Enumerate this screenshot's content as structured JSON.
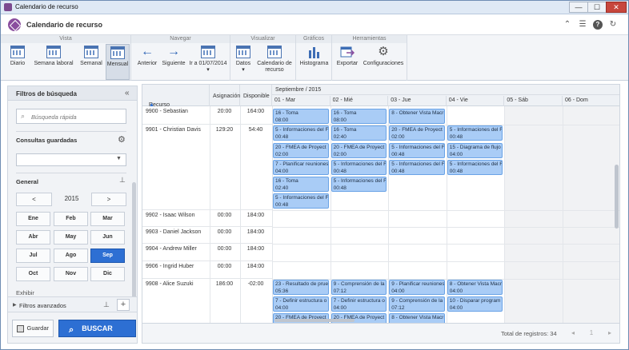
{
  "window": {
    "title": "Calendario de recurso",
    "minimize": "—",
    "maximize": "☐",
    "close": "✕"
  },
  "header": {
    "title": "Calendario de recurso"
  },
  "ribbon": {
    "groups": [
      "Vista",
      "Navegar",
      "Visualizar",
      "Gráficos",
      "Herramientas"
    ],
    "vista": [
      "Diario",
      "Semana laboral",
      "Semanal",
      "Mensual"
    ],
    "navegar": [
      "Anterior",
      "Siguiente",
      "Ir a 01/07/2014"
    ],
    "visualizar": [
      "Datos",
      "Calendario de recurso"
    ],
    "graficos": [
      "Histograma"
    ],
    "herramientas": [
      "Exportar",
      "Configuraciones"
    ]
  },
  "sidebar": {
    "title": "Filtros de búsqueda",
    "search_placeholder": "Búsqueda rápida",
    "saved_queries": "Consultas guardadas",
    "general": "General",
    "prev": "<",
    "next": ">",
    "year": "2015",
    "months": [
      "Ene",
      "Feb",
      "Mar",
      "Abr",
      "May",
      "Jun",
      "Jul",
      "Ago",
      "Sep",
      "Oct",
      "Nov",
      "Dic"
    ],
    "selected_month": "Sep",
    "exhibir": "Exhibir",
    "advanced": "Filtros avanzados",
    "save": "Guardar",
    "search_btn": "BUSCAR"
  },
  "grid": {
    "columns": [
      "Recurso",
      "Asignación",
      "Disponible"
    ],
    "month_label": "Septiembre / 2015",
    "days": [
      "01 - Mar",
      "02 - Mié",
      "03 - Jue",
      "04 - Vie",
      "05 - Sáb",
      "06 - Dom"
    ],
    "rows": [
      {
        "name": "9900 - Sebastian",
        "asig": "20:00",
        "disp": "164:00"
      },
      {
        "name": "9901 - Christian Davis",
        "asig": "129:20",
        "disp": "54:40"
      },
      {
        "name": "9902 - Isaac Wilson",
        "asig": "00:00",
        "disp": "184:00"
      },
      {
        "name": "9903 - Daniel Jackson",
        "asig": "00:00",
        "disp": "184:00"
      },
      {
        "name": "9904 - Andrew Miller",
        "asig": "00:00",
        "disp": "184:00"
      },
      {
        "name": "9906 - Ingrid Huber",
        "asig": "00:00",
        "disp": "184:00"
      },
      {
        "name": "9908 - Alice Suzuki",
        "asig": "186:00",
        "disp": "-02:00"
      }
    ],
    "events": [
      [
        "16 - Toma",
        "08:00"
      ],
      [
        "16 - Toma",
        "08:00"
      ],
      [
        "8 - Obtener Vista Macr",
        ""
      ],
      [
        "5 - Informaciones del F",
        "00:48"
      ],
      [
        "16 - Toma",
        "02:40"
      ],
      [
        "20 - FMEA de Proyect",
        "02:00"
      ],
      [
        "5 - Informaciones del F",
        "00:48"
      ],
      [
        "20 - FMEA de Proyect",
        "02:00"
      ],
      [
        "20 - FMEA de Proyect",
        "02:00"
      ],
      [
        "5 - Informaciones del F",
        "00:48"
      ],
      [
        "15 - Diagrama de flujo",
        "04:00"
      ],
      [
        "7 - Planificar reuniones",
        "04:00"
      ],
      [
        "5 - Informaciones del F",
        "00:48"
      ],
      [
        "5 - Informaciones del F",
        "00:48"
      ],
      [
        "5 - Informaciones del F",
        "00:48"
      ],
      [
        "16 - Toma",
        "02:40"
      ],
      [
        "5 - Informaciones del F",
        "00:48"
      ],
      [
        "5 - Informaciones del F",
        "00:48"
      ],
      [
        "23 - Resultado de prue",
        "05:36"
      ],
      [
        "9 - Comprensión de la",
        "07:12"
      ],
      [
        "9 - Planificar reuniones",
        "04:00"
      ],
      [
        "8 - Obtener Vista Macr",
        "04:00"
      ],
      [
        "7 - Definir estructura o",
        "04:00"
      ],
      [
        "7 - Definir estructura o",
        "04:00"
      ],
      [
        "9 - Comprensión de la",
        "07:12"
      ],
      [
        "10 - Disparar program",
        "04:00"
      ],
      [
        "20 - FMEA de Proyect",
        ""
      ],
      [
        "20 - FMEA de Proyect",
        ""
      ],
      [
        "8 - Obtener Vista Macr",
        ""
      ]
    ]
  },
  "footer": {
    "total": "Total de registros: 34",
    "first": "◂",
    "page": "1",
    "last": "▸"
  }
}
